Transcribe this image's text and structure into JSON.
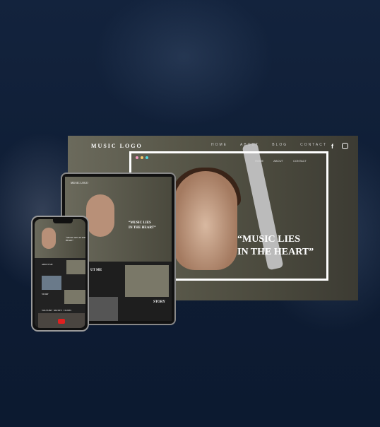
{
  "desktop": {
    "logo": "MUSIC LOGO",
    "nav": [
      "HOME",
      "ABOUT",
      "BLOG",
      "CONTACT"
    ],
    "social": [
      "facebook-icon",
      "instagram-icon"
    ],
    "inner_nav": [
      "HOME",
      "ABOUT",
      "CONTACT"
    ],
    "quote_line1": "“MUSIC LIES",
    "quote_line2": "IN THE HEART”",
    "dot_colors": [
      "#f49ac1",
      "#f5c86a",
      "#4fd6e0"
    ]
  },
  "tablet": {
    "logo": "MUSIC LOGO",
    "quote_line1": "“MUSIC LIES",
    "quote_line2": "IN THE HEART”",
    "about": "UT ME",
    "story": "STORY"
  },
  "phone": {
    "quote": "“MUSIC LIES IN THE HEART”",
    "about": "ABOUT ME",
    "story": "STORY",
    "links": "YOUTUBE · SPOTIFY · ITUNES"
  }
}
